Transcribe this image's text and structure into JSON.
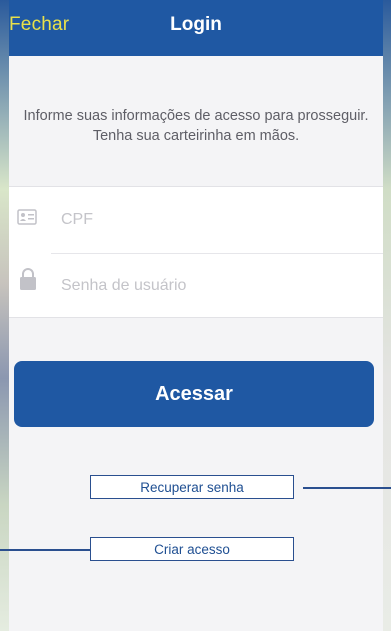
{
  "navbar": {
    "close_label": "Fechar",
    "title": "Login"
  },
  "instructions": {
    "line1": "Informe suas informações de acesso para prosseguir.",
    "line2": "Tenha sua carteirinha em mãos."
  },
  "form": {
    "cpf": {
      "placeholder": "CPF",
      "value": "",
      "icon": "id-card-icon"
    },
    "password": {
      "placeholder": "Senha de usuário",
      "value": "",
      "icon": "lock-icon"
    }
  },
  "actions": {
    "submit_label": "Acessar",
    "recover_label": "Recuperar senha",
    "create_label": "Criar acesso"
  },
  "colors": {
    "primary": "#1f58a3",
    "close_text": "#e8e14a",
    "background": "#f4f4f6",
    "annotation": "#2a4f8f"
  }
}
